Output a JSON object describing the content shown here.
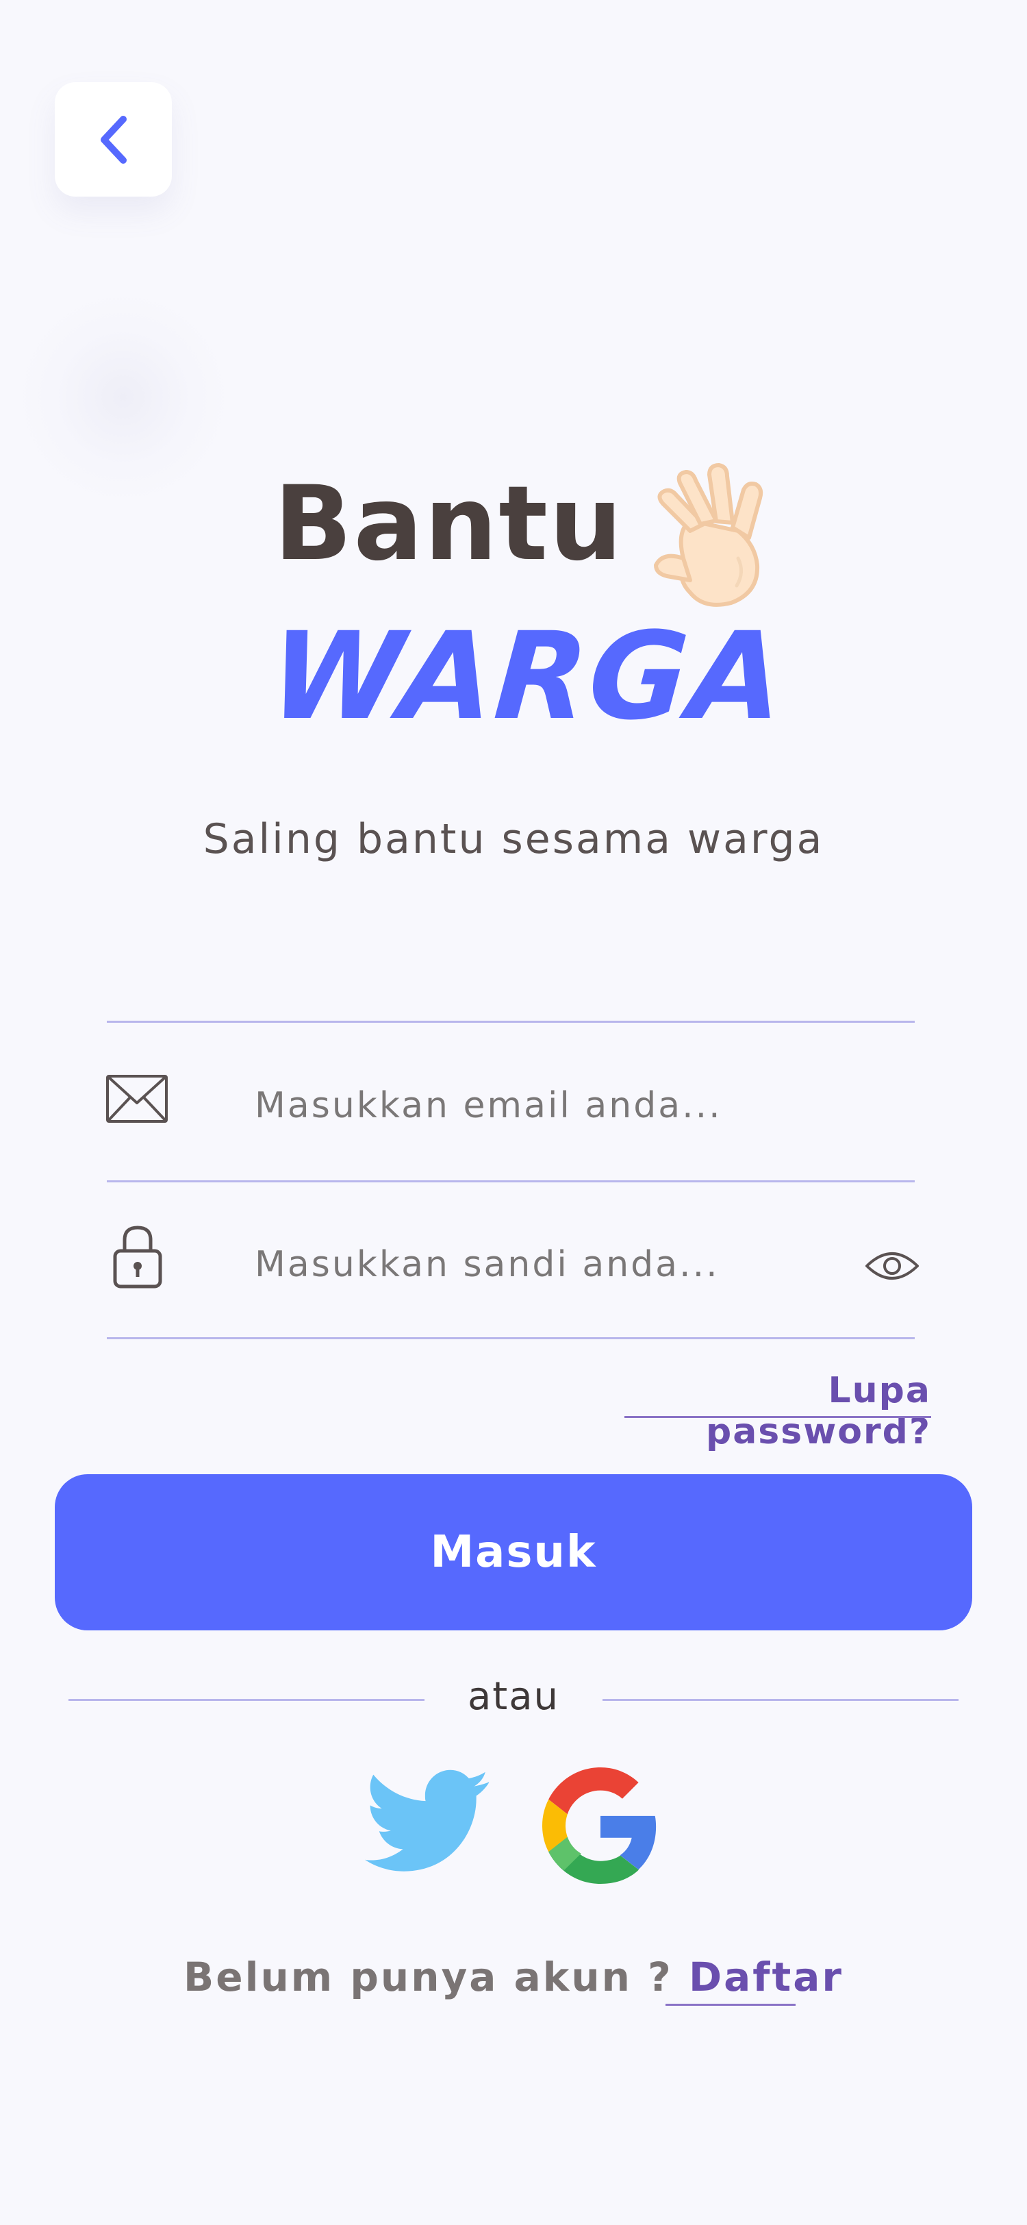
{
  "header": {
    "back_icon": "chevron-left-icon"
  },
  "brand": {
    "line1": "Bantu",
    "line2": "WARGA",
    "wave_icon": "waving-hand-icon",
    "tagline": "Saling bantu sesama warga"
  },
  "form": {
    "email": {
      "icon": "envelope-icon",
      "placeholder": "Masukkan email anda..."
    },
    "password": {
      "icon": "lock-icon",
      "placeholder": "Masukkan sandi anda...",
      "toggle_icon": "eye-icon"
    },
    "forgot_label": "Lupa password?",
    "submit_label": "Masuk"
  },
  "divider": {
    "label": "atau"
  },
  "social": {
    "twitter_icon": "twitter-icon",
    "google_icon": "google-icon"
  },
  "footer": {
    "prompt": "Belum punya akun ?",
    "link": "Daftar"
  },
  "colors": {
    "background": "#f8f8fd",
    "accent": "#5669fe",
    "link": "#6a4fae",
    "title_dark": "#4a403e",
    "field_line": "#b8b6ec"
  }
}
